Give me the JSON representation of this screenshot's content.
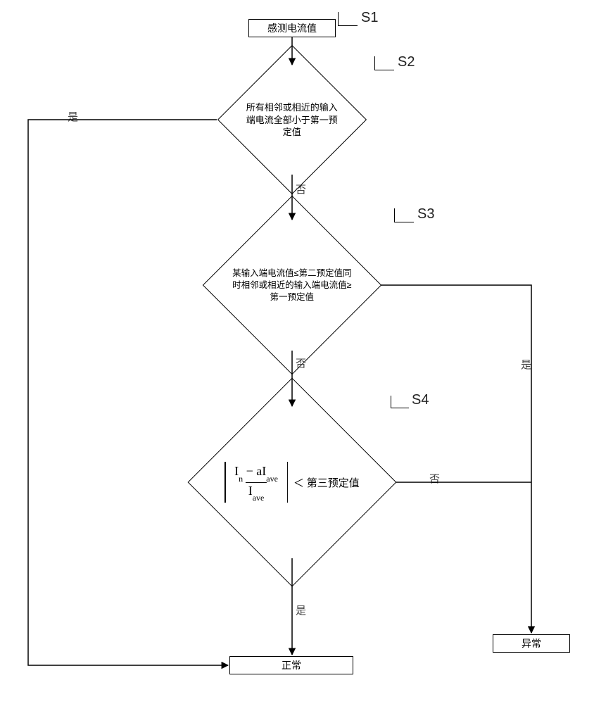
{
  "steps": {
    "s1": {
      "id": "S1",
      "text": "感测电流值"
    },
    "s2": {
      "id": "S2",
      "text": "所有相邻或相近的输入端电流全部小于第一预定值"
    },
    "s3": {
      "id": "S3",
      "text": "某输入端电流值≤第二预定值同时相邻或相近的输入端电流值≥第一预定值"
    },
    "s4": {
      "id": "S4",
      "formula_num": "Iₙ − aIave",
      "formula_den": "Iave",
      "compare": "＜ 第三预定值"
    }
  },
  "labels": {
    "yes": "是",
    "no": "否"
  },
  "terminals": {
    "normal": "正常",
    "abnormal": "异常"
  },
  "chart_data": {
    "type": "table",
    "title": "Flowchart: fault detection by input-terminal current comparison",
    "nodes": [
      {
        "id": "S1",
        "type": "process",
        "text": "感测电流值"
      },
      {
        "id": "S2",
        "type": "decision",
        "text": "所有相邻或相近的输入端电流全部小于第一预定值"
      },
      {
        "id": "S3",
        "type": "decision",
        "text": "某输入端电流值≤第二预定值同时相邻或相近的输入端电流值≥第一预定值"
      },
      {
        "id": "S4",
        "type": "decision",
        "text": "|I_n − a·I_ave| / I_ave ＜ 第三预定值"
      },
      {
        "id": "NORMAL",
        "type": "terminal",
        "text": "正常"
      },
      {
        "id": "ABNORMAL",
        "type": "terminal",
        "text": "异常"
      }
    ],
    "edges": [
      {
        "from": "S1",
        "to": "S2",
        "label": ""
      },
      {
        "from": "S2",
        "to": "S3",
        "label": "否"
      },
      {
        "from": "S2",
        "to": "NORMAL",
        "label": "是"
      },
      {
        "from": "S3",
        "to": "S4",
        "label": "否"
      },
      {
        "from": "S3",
        "to": "ABNORMAL",
        "label": "是"
      },
      {
        "from": "S4",
        "to": "NORMAL",
        "label": "是"
      },
      {
        "from": "S4",
        "to": "ABNORMAL",
        "label": "否"
      }
    ]
  }
}
